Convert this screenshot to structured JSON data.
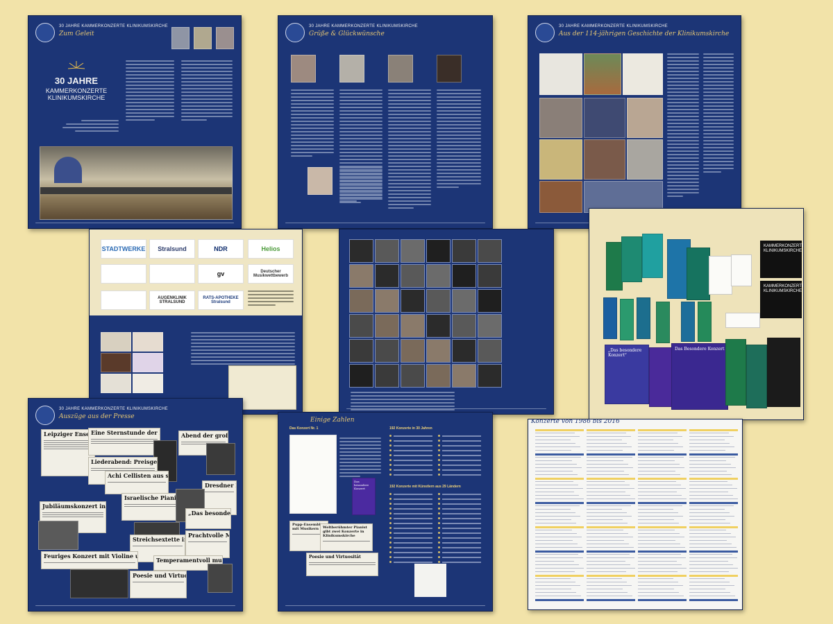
{
  "spreads": [
    {
      "id": "zum-geleit",
      "header": "30 JAHRE KAMMERKONZERTE KLINIKUMSKIRCHE",
      "subtitle": "Zum Geleit",
      "cover_title_line1": "30 JAHRE",
      "cover_title_line2": "KAMMERKONZERTE",
      "cover_title_line3": "KLINIKUMSKIRCHE"
    },
    {
      "id": "grusse",
      "header": "30 JAHRE KAMMERKONZERTE KLINIKUMSKIRCHE",
      "subtitle": "Grüße & Glückwünsche"
    },
    {
      "id": "geschichte",
      "header": "30 JAHRE KAMMERKONZERTE KLINIKUMSKIRCHE",
      "subtitle": "Aus der 114-jährigen Geschichte der Klinikumskirche"
    },
    {
      "id": "sponsoren",
      "logos": [
        "STADTWERKE",
        "Stralsund",
        "NDR",
        "Helios",
        "",
        "",
        "gv",
        "Deutscher Musikwettbewerb",
        "",
        "AUGENKLINIK STRALSUND",
        "RATS-APOTHEKE Stralsund",
        ""
      ]
    },
    {
      "id": "kuenstler"
    },
    {
      "id": "plakate",
      "banner_1": "KAMMERKONZERTE KLINIKUMSKIRCHE",
      "banner_2": "KAMMERKONZERTE KLINIKUMSKIRCHE",
      "flyer_a": "„Das besondere Konzert“",
      "flyer_b": "Das Besondere Konzert"
    },
    {
      "id": "auszuege",
      "header": "30 JAHRE KAMMERKONZERTE KLINIKUMSKIRCHE",
      "subtitle": "Auszüge aus der Presse",
      "clippings": [
        "Leipziger Ensemble sorgte für Hörvergnügen",
        "Eine Sternstunde der Kammermusik",
        "Abend der großen Emotionen",
        "Liederabend: Preisgekrönte Sopranistin singt in Klinikumskirche",
        "Achi Cellisten aus sieben Ländern",
        "Jubiläumskonzert in der Klinikumskirche",
        "Dresdner Klaviertrio zu Gast",
        "Israelische Pianistin spielt in Klinikumskirche",
        "„Das besondere Konzert“",
        "Streichsextette in Klinikumskirche",
        "Feuriges Konzert mit Violine und Zimbal",
        "Prachtvolle Musik",
        "Poesie und Virtuosität",
        "Temperamentvoll musiziert"
      ]
    },
    {
      "id": "zahlen",
      "subtitle": "Einige Zahlen",
      "section_1": "Das Konzert Nr. 1",
      "section_2": "192 Konzerte in 30 Jahren",
      "section_3": "192 Konzerte mit Künstlern aus 29 Ländern",
      "clip_1": "Pupp-Ensemble mit Musikern",
      "clip_2": "Weltberühmter Pianist gibt zwei Konzerte in Klinikumskirche",
      "clip_3": "Poesie und Virtuosität",
      "flyer": "Das besondere Konzert"
    },
    {
      "id": "konzerte",
      "subtitle": "Konzerte von 1986 bis 2016"
    }
  ]
}
